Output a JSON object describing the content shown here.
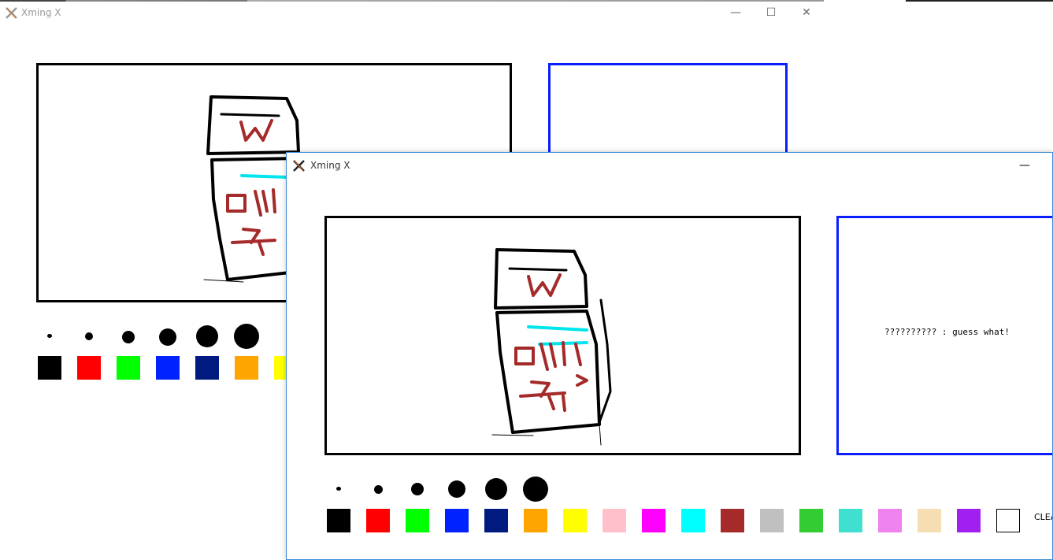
{
  "back_window": {
    "title": "Xming X",
    "controls": {
      "minimize": "—",
      "maximize": "☐",
      "close": "✕"
    }
  },
  "front_window": {
    "title": "Xming X",
    "controls": {
      "minimize": "—"
    },
    "chat": {
      "message": "?????????? : guess what!"
    },
    "clear_label": "CLEAR"
  },
  "palette": {
    "brush_sizes": [
      "tiny",
      "small",
      "medium",
      "large",
      "x-large",
      "xx-large"
    ],
    "colors": [
      "#000000",
      "#ff0000",
      "#00ff00",
      "#0022ff",
      "#001a80",
      "#ffa500",
      "#ffff00",
      "#ffc0cb",
      "#ff00ff",
      "#00ffff",
      "#a52a2a",
      "#c0c0c0",
      "#33cc33",
      "#40e0d0",
      "#ee82ee",
      "#f5deb3",
      "#a020f0",
      "#ffffff"
    ]
  }
}
